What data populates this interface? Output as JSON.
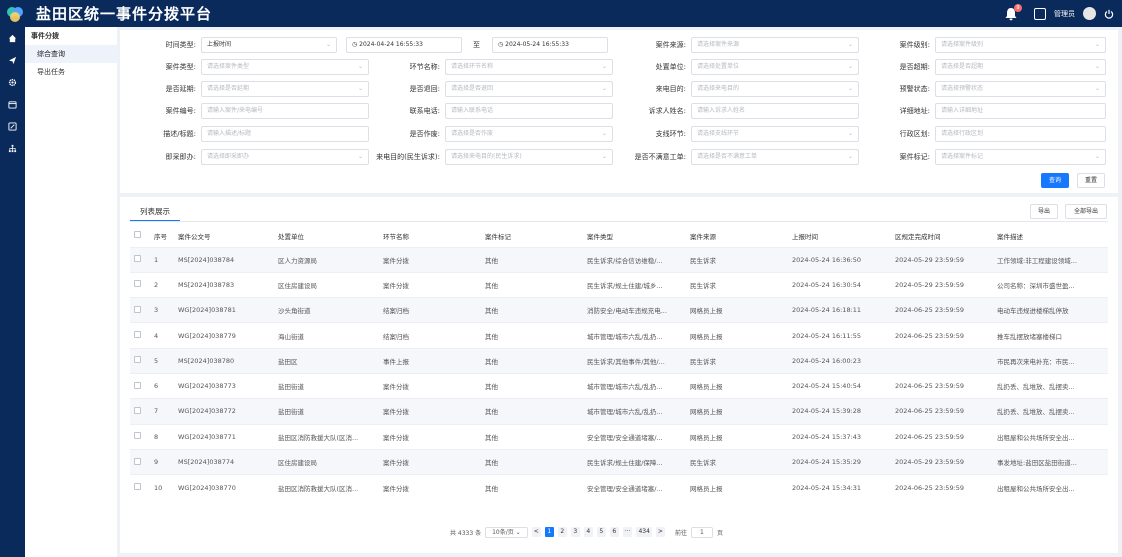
{
  "app": {
    "title": "盐田区统一事件分拨平台",
    "bell_count": "9",
    "user": "管理员"
  },
  "sidebar": {
    "group": "事件分拨",
    "items": [
      {
        "label": "综合查询"
      },
      {
        "label": "导出任务"
      }
    ]
  },
  "filters": {
    "time_type": {
      "label": "时间类型:",
      "value": "上报时间"
    },
    "start": "2024-04-24 16:55:33",
    "to": "至",
    "end": "2024-05-24 16:55:33",
    "source": {
      "label": "案件来源:",
      "ph": "请选择案件来源"
    },
    "level": {
      "label": "案件级别:",
      "ph": "请选择案件级别"
    },
    "case_type": {
      "label": "案件类型:",
      "ph": "请选择案件类型"
    },
    "node": {
      "label": "环节名称:",
      "ph": "请选择环节名称"
    },
    "unit": {
      "label": "处置单位:",
      "ph": "请选择处置单位"
    },
    "overdue": {
      "label": "是否超期:",
      "ph": "请选择是否超期"
    },
    "delay": {
      "label": "是否延期:",
      "ph": "请选择是否延期"
    },
    "returned": {
      "label": "是否退回:",
      "ph": "请选择是否退回"
    },
    "origin": {
      "label": "来电目的:",
      "ph": "请选择来电目的"
    },
    "alarm": {
      "label": "预警状态:",
      "ph": "请选择预警状态"
    },
    "case_no": {
      "label": "案件编号:",
      "ph": "请输入案件/来电编号"
    },
    "phone": {
      "label": "联系电话:",
      "ph": "请输入联系电话"
    },
    "person": {
      "label": "诉求人姓名:",
      "ph": "请输入诉求人姓名"
    },
    "address": {
      "label": "详细地址:",
      "ph": "请输入详细地址"
    },
    "desc": {
      "label": "描述/标题:",
      "ph": "请输入描述/标题"
    },
    "invalid": {
      "label": "是否作废:",
      "ph": "请选择是否作废"
    },
    "support": {
      "label": "支线环节:",
      "ph": "请选择支线环节"
    },
    "district": {
      "label": "行政区划:",
      "ph": "请选择行政区划"
    },
    "instant": {
      "label": "即采即办:",
      "ph": "请选择即采即办"
    },
    "purpose": {
      "label": "来电目的(民生诉求):",
      "ph": "请选择来电目的(民生诉求)"
    },
    "unsatisfied": {
      "label": "是否不满意工单:",
      "ph": "请选择是否不满意工单"
    },
    "mark": {
      "label": "案件标记:",
      "ph": "请选择案件标记"
    },
    "query_btn": "查询",
    "reset_btn": "重置"
  },
  "list": {
    "tab": "列表展示",
    "export_btn": "导出",
    "export_all_btn": "全部导出",
    "columns": [
      "序号",
      "案件公文号",
      "处置单位",
      "环节名称",
      "案件标记",
      "案件类型",
      "案件来源",
      "上报时间",
      "区规定完成时间",
      "案件描述"
    ],
    "rows": [
      [
        "1",
        "MS[2024]038784",
        "区人力资源局",
        "案件分拨",
        "其他",
        "民生诉求/综合信访维稳/...",
        "民生诉求",
        "2024-05-24 16:36:50",
        "2024-05-29 23:59:59",
        "工作领域:非工程建设领域..."
      ],
      [
        "2",
        "MS[2024]038783",
        "区住房建设局",
        "案件分拨",
        "其他",
        "民生诉求/规土住建/城乡...",
        "民生诉求",
        "2024-05-24 16:30:54",
        "2024-05-29 23:59:59",
        "公司名称：深圳市盛世盈..."
      ],
      [
        "3",
        "WG[2024]038781",
        "沙头角街道",
        "结案归档",
        "其他",
        "消防安全/电动车违规充电...",
        "网格员上报",
        "2024-05-24 16:18:11",
        "2024-06-25 23:59:59",
        "电动车违规进楼梯乱停放"
      ],
      [
        "4",
        "WG[2024]038779",
        "海山街道",
        "结案归档",
        "其他",
        "城市管理/城市六乱/乱扔...",
        "网格员上报",
        "2024-05-24 16:11:55",
        "2024-06-25 23:59:59",
        "推车乱摆放堵塞楼梯口"
      ],
      [
        "5",
        "MS[2024]038780",
        "盐田区",
        "事件上报",
        "其他",
        "民生诉求/其他事件/其他/...",
        "民生诉求",
        "2024-05-24 16:00:23",
        "",
        "市民再次来电补充：市民..."
      ],
      [
        "6",
        "WG[2024]038773",
        "盐田街道",
        "案件分拨",
        "其他",
        "城市管理/城市六乱/乱扔...",
        "网格员上报",
        "2024-05-24 15:40:54",
        "2024-06-25 23:59:59",
        "乱扔丢、乱堆放、乱摆卖..."
      ],
      [
        "7",
        "WG[2024]038772",
        "盐田街道",
        "案件分拨",
        "其他",
        "城市管理/城市六乱/乱扔...",
        "网格员上报",
        "2024-05-24 15:39:28",
        "2024-06-25 23:59:59",
        "乱扔丢、乱堆放、乱摆卖..."
      ],
      [
        "8",
        "WG[2024]038771",
        "盐田区消防救援大队(区消...",
        "案件分拨",
        "其他",
        "安全管理/安全通道堵塞/...",
        "网格员上报",
        "2024-05-24 15:37:43",
        "2024-06-25 23:59:59",
        "出租屋和公共场所安全出..."
      ],
      [
        "9",
        "MS[2024]038774",
        "区住房建设局",
        "案件分拨",
        "其他",
        "民生诉求/规土住建/保障...",
        "民生诉求",
        "2024-05-24 15:35:29",
        "2024-05-29 23:59:59",
        "事发地址:盐田区盐田街道..."
      ],
      [
        "10",
        "WG[2024]038770",
        "盐田区消防救援大队(区消...",
        "案件分拨",
        "其他",
        "安全管理/安全通道堵塞/...",
        "网格员上报",
        "2024-05-24 15:34:31",
        "2024-06-25 23:59:59",
        "出租屋和公共场所安全出..."
      ]
    ]
  },
  "pagination": {
    "total": "共 4333 条",
    "page_size": "10条/页",
    "prev": "<",
    "pages": [
      "1",
      "2",
      "3",
      "4",
      "5",
      "6",
      "···",
      "434"
    ],
    "next": ">",
    "goto_label": "前往",
    "goto_value": "1",
    "goto_suffix": "页"
  },
  "colors": {
    "topbar": "#0a2a5c",
    "primary": "#1677ff"
  }
}
